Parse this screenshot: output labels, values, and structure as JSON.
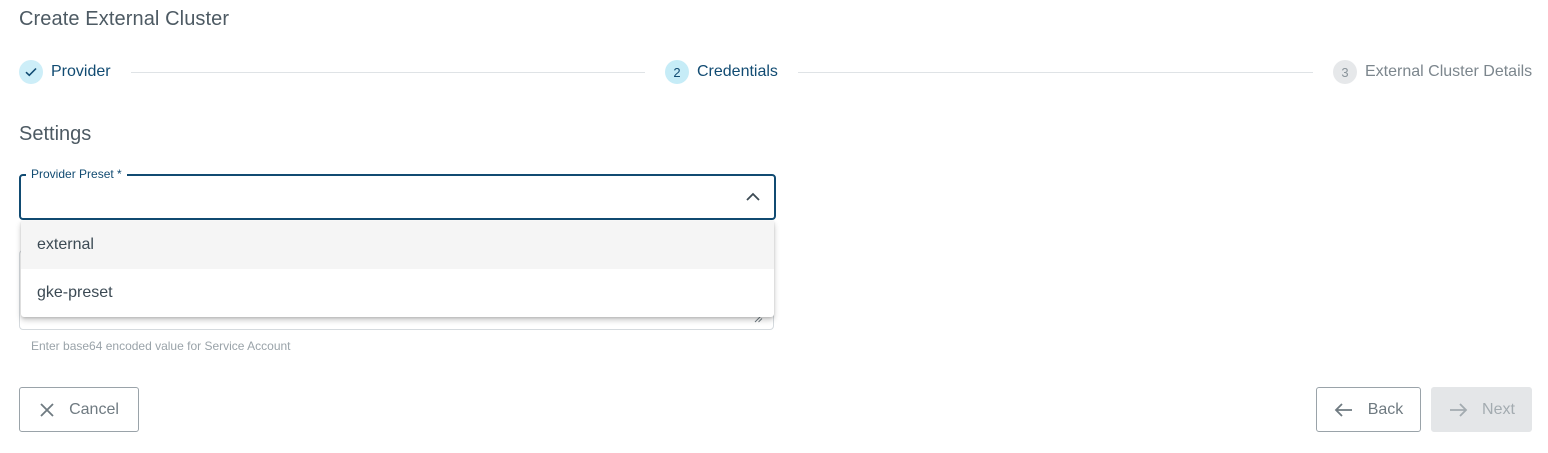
{
  "header": {
    "title": "Create External Cluster"
  },
  "stepper": {
    "steps": [
      {
        "label": "Provider",
        "state": "done",
        "icon": "check-icon"
      },
      {
        "number": "2",
        "label": "Credentials",
        "state": "active"
      },
      {
        "number": "3",
        "label": "External Cluster Details",
        "state": "pending"
      }
    ]
  },
  "settings": {
    "title": "Settings",
    "provider_preset": {
      "label": "Provider Preset *",
      "value": "",
      "options": [
        "external",
        "gke-preset"
      ],
      "highlighted_option": "external"
    },
    "service_account": {
      "hint": "Enter base64 encoded value for Service Account"
    }
  },
  "actions": {
    "cancel_label": "Cancel",
    "back_label": "Back",
    "next_label": "Next"
  },
  "colors": {
    "primary": "#114b72",
    "step_active_bg": "#c6ecf7",
    "disabled_bg": "#e4e6e8"
  }
}
